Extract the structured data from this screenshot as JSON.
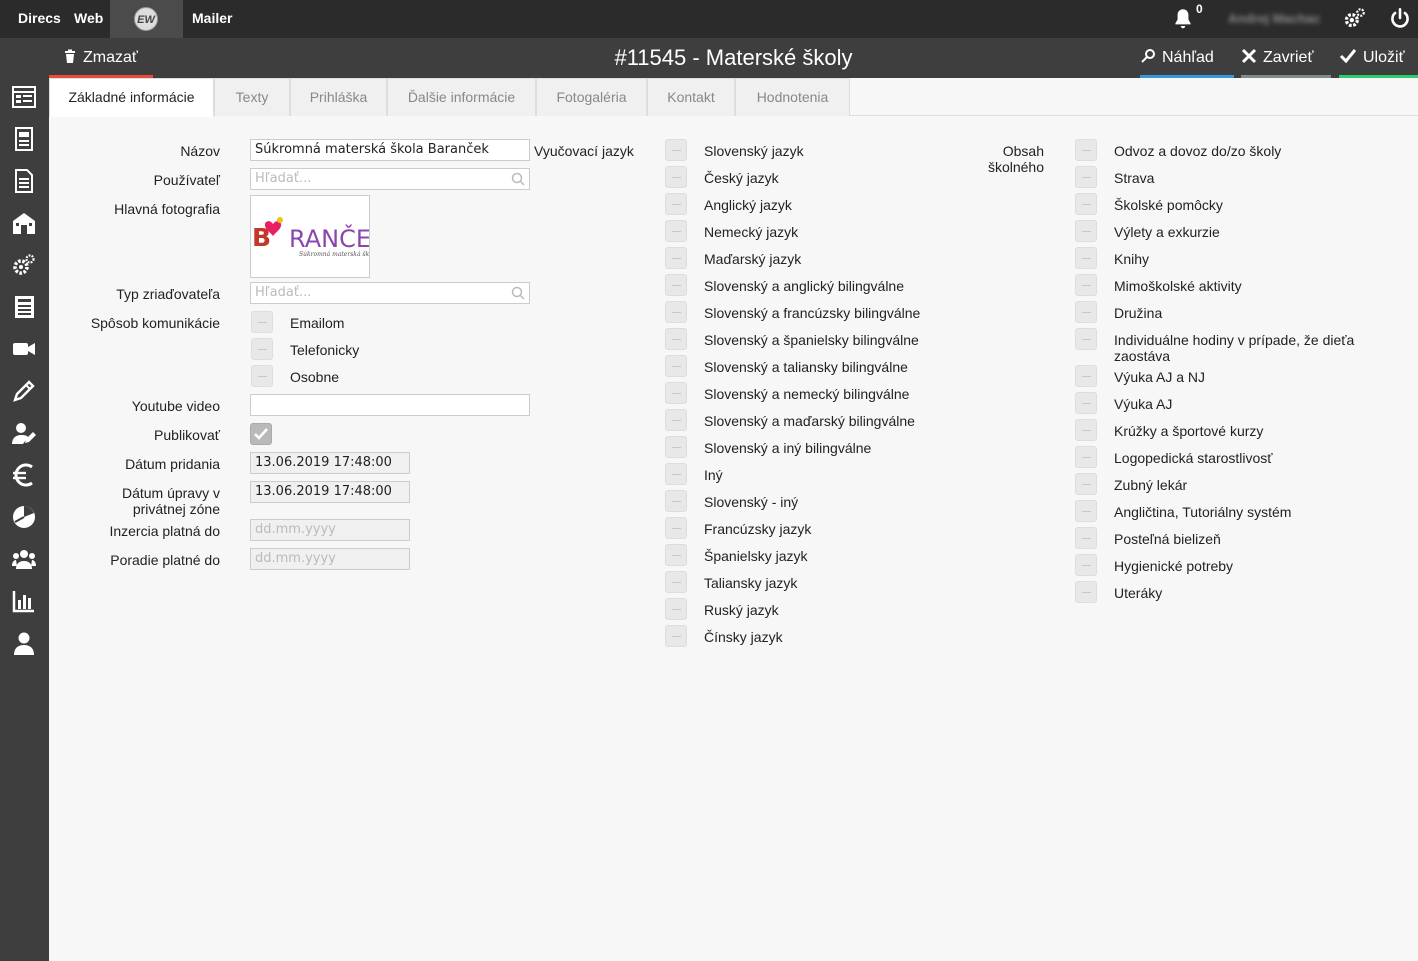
{
  "topbar": {
    "nav": [
      "Direcs",
      "Web",
      "Mailer"
    ],
    "logo_text": "EW",
    "notification_count": "0",
    "username": "Andrej Machac"
  },
  "actionbar": {
    "delete_label": "Zmazať",
    "title": "#11545 - Materské školy",
    "preview_label": "Náhľad",
    "close_label": "Zavrieť",
    "save_label": "Uložiť"
  },
  "tabs": [
    "Základné informácie",
    "Texty",
    "Prihláška",
    "Ďalšie informácie",
    "Fotogaléria",
    "Kontakt",
    "Hodnotenia"
  ],
  "form": {
    "name_label": "Názov",
    "name_value": "Súkromná materská škola Baranček",
    "user_label": "Používateľ",
    "search_placeholder": "Hľadať...",
    "photo_label": "Hlavná fotografia",
    "photo_logo_text": "BARANČEK",
    "photo_logo_sub": "Súkromná materská škola",
    "founder_label": "Typ zriaďovateľa",
    "comm_label": "Spôsob komunikácie",
    "comm_options": [
      "Emailom",
      "Telefonicky",
      "Osobne"
    ],
    "youtube_label": "Youtube video",
    "youtube_value": "",
    "publish_label": "Publikovať",
    "publish_checked": true,
    "added_label": "Dátum pridania",
    "added_value": "13.06.2019 17:48:00",
    "modified_label_1": "Dátum úpravy v",
    "modified_label_2": "privátnej zóne",
    "modified_value": "13.06.2019 17:48:00",
    "ad_label": "Inzercia platná do",
    "ad_placeholder": "dd.mm.yyyy",
    "order_label": "Poradie platné do",
    "order_placeholder": "dd.mm.yyyy"
  },
  "languages": {
    "label": "Vyučovací jazyk",
    "options": [
      "Slovenský jazyk",
      "Český jazyk",
      "Anglický jazyk",
      "Nemecký jazyk",
      "Maďarský jazyk",
      "Slovenský a anglický bilingválne",
      "Slovenský a francúzsky bilingválne",
      "Slovenský a španielsky bilingválne",
      "Slovenský a taliansky bilingválne",
      "Slovenský a nemecký bilingválne",
      "Slovenský a maďarský bilingválne",
      "Slovenský a iný bilingválne",
      "Iný",
      "Slovenský - iný",
      "Francúzsky jazyk",
      "Španielsky jazyk",
      "Taliansky jazyk",
      "Ruský jazyk",
      "Čínsky jazyk"
    ]
  },
  "tuition": {
    "label_1": "Obsah",
    "label_2": "školného",
    "options": [
      "Odvoz a dovoz do/zo školy",
      "Strava",
      "Školské pomôcky",
      "Výlety a exkurzie",
      "Knihy",
      "Mimoškolské aktivity",
      "Družina",
      "Individuálne hodiny v prípade, že dieťa",
      "Výuka AJ a NJ",
      "Výuka AJ",
      "Krúžky a športové kurzy",
      "Logopedická starostlivosť",
      "Zubný lekár",
      "Angličtina, Tutoriálny systém",
      "Posteľná bielizeň",
      "Hygienické potreby",
      "Uteráky"
    ],
    "wrap_line": "zaostáva"
  },
  "colors": {
    "topbar": "#2b2b2b",
    "bars": "#3e3e3e",
    "delete_accent": "#e74c3c",
    "preview_accent": "#3498db",
    "close_accent": "#7f8c8d",
    "save_accent": "#2ecc71"
  }
}
